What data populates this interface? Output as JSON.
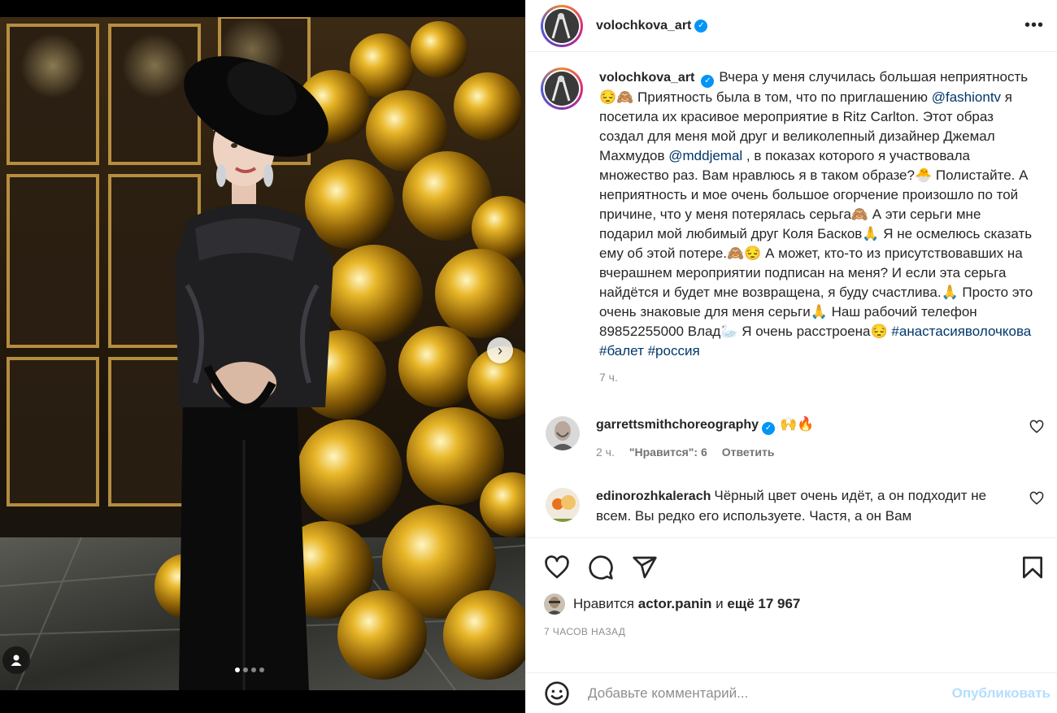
{
  "post": {
    "author": "volochkova_art",
    "more_icon": "more-horizontal-icon",
    "carousel": {
      "slide_count": 4,
      "active_slide": 1
    }
  },
  "caption": {
    "author": "volochkova_art",
    "segments": [
      {
        "type": "text",
        "value": "Вчера у меня случилась большая неприятность😔🙈 Приятность была в том, что по приглашению "
      },
      {
        "type": "link",
        "value": "@fashiontv"
      },
      {
        "type": "text",
        "value": " я посетила их красивое мероприятие в Ritz Carlton. Этот образ создал для меня мой друг и великолепный дизайнер Джемал Махмудов "
      },
      {
        "type": "link",
        "value": "@mddjemal"
      },
      {
        "type": "text",
        "value": " , в показах которого я участвовала множество раз. Вам нравлюсь я в таком образе?🐣 Полистайте. А неприятность и мое очень большое огорчение произошло по той причине, что у меня потерялась серьга🙈 А эти серьги мне подарил мой любимый друг Коля Басков🙏 Я не осмелюсь сказать ему об этой потере.🙈😔 А может, кто-то из присутствовавших на вчерашнем мероприятии подписан на меня? И если эта серьга найдётся и будет мне возвращена, я буду счастлива.🙏 Просто это очень знаковые для меня серьги🙏 Наш рабочий телефон 89852255000 Влад🦢 Я очень расстроена😔 "
      },
      {
        "type": "link",
        "value": "#анастасияволочкова"
      },
      {
        "type": "text",
        "value": " "
      },
      {
        "type": "link",
        "value": "#балет"
      },
      {
        "type": "text",
        "value": " "
      },
      {
        "type": "link",
        "value": "#россия"
      }
    ],
    "time": "7 ч."
  },
  "comments": [
    {
      "user": "garrettsmithchoreography",
      "verified": true,
      "text": "🙌🔥",
      "time": "2 ч.",
      "likes": "\"Нравится\": 6",
      "reply": "Ответить"
    },
    {
      "user": "edinorozhkalerach",
      "verified": false,
      "text": "Чёрный цвет очень идёт, а он подходит не всем. Вы редко его используете. Частя, а он Вам"
    }
  ],
  "actions": {
    "like_icon": "heart-icon",
    "comment_icon": "comment-icon",
    "share_icon": "paper-plane-icon",
    "save_icon": "bookmark-icon"
  },
  "likes": {
    "prefix": "Нравится",
    "user": "actor.panin",
    "middle": "и",
    "rest": "ещё 17 967"
  },
  "timestamp": "7 часов назад",
  "add_comment": {
    "placeholder": "Добавьте комментарий...",
    "publish": "Опубликовать"
  },
  "colors": {
    "link": "#00376b",
    "verified": "#0095f6",
    "publish_disabled": "#b2dffc",
    "muted": "#8e8e8e"
  }
}
